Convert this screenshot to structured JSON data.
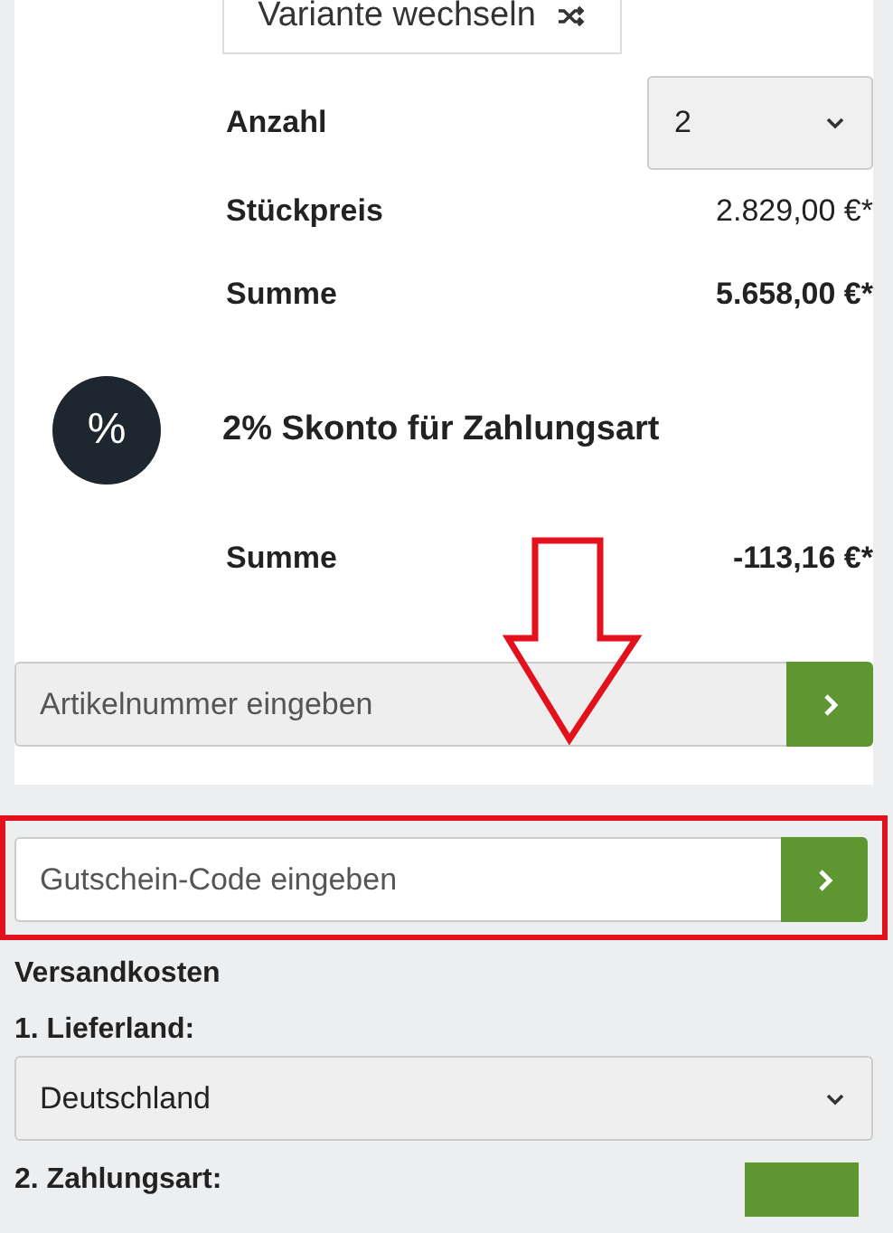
{
  "variant_button": {
    "label": "Variante wechseln"
  },
  "summary": [
    {
      "kind": "select",
      "label": "Anzahl",
      "value": "2"
    },
    {
      "kind": "price",
      "label": "Stückpreis",
      "value": "2.829,00 €*"
    },
    {
      "kind": "total",
      "label": "Summe",
      "value": "5.658,00 €*"
    }
  ],
  "discount": {
    "icon": "%",
    "title": "2% Skonto für Zahlungsart",
    "label": "Summe",
    "value": "-113,16 €*"
  },
  "article_field": {
    "placeholder": "Artikelnummer eingeben"
  },
  "voucher_field": {
    "placeholder": "Gutschein-Code eingeben"
  },
  "shipping": {
    "heading": "Versandkosten",
    "country_label": "1. Lieferland:",
    "country": "Deutschland",
    "payment_label": "2. Zahlungsart:"
  }
}
